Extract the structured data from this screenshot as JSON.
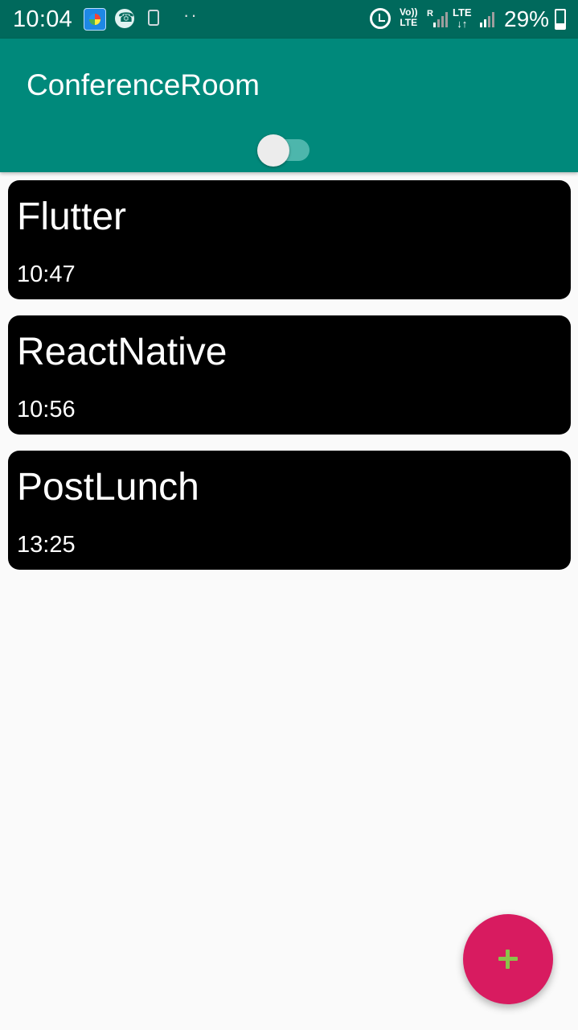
{
  "status_bar": {
    "time": "10:04",
    "volte_line1": "Vo))",
    "volte_line2": "LTE",
    "network_roaming": "R",
    "lte_label": "LTE",
    "lte_arrows": "↓↑",
    "battery_percent": "29%",
    "battery_level": 0.29,
    "icons": [
      "app-notification-icon",
      "phone-call-icon",
      "clipboard-icon",
      "more-dots-icon",
      "alarm-icon",
      "volte-icon",
      "signal-icon",
      "lte-icon",
      "signal-icon",
      "battery-icon"
    ]
  },
  "app_bar": {
    "title": "ConferenceRoom",
    "toggle": {
      "on": false
    }
  },
  "meetings": [
    {
      "title": "Flutter",
      "time": "10:47"
    },
    {
      "title": "ReactNative",
      "time": "10:56"
    },
    {
      "title": "PostLunch",
      "time": "13:25"
    }
  ],
  "fab": {
    "icon": "plus-icon"
  },
  "colors": {
    "status_bar": "#00695c",
    "app_bar": "#00897b",
    "background": "#fafafa",
    "card": "#000000",
    "fab": "#d81b60",
    "fab_icon": "#8bc34a",
    "switch_track": "#4db6ac",
    "switch_thumb": "#ececec"
  }
}
